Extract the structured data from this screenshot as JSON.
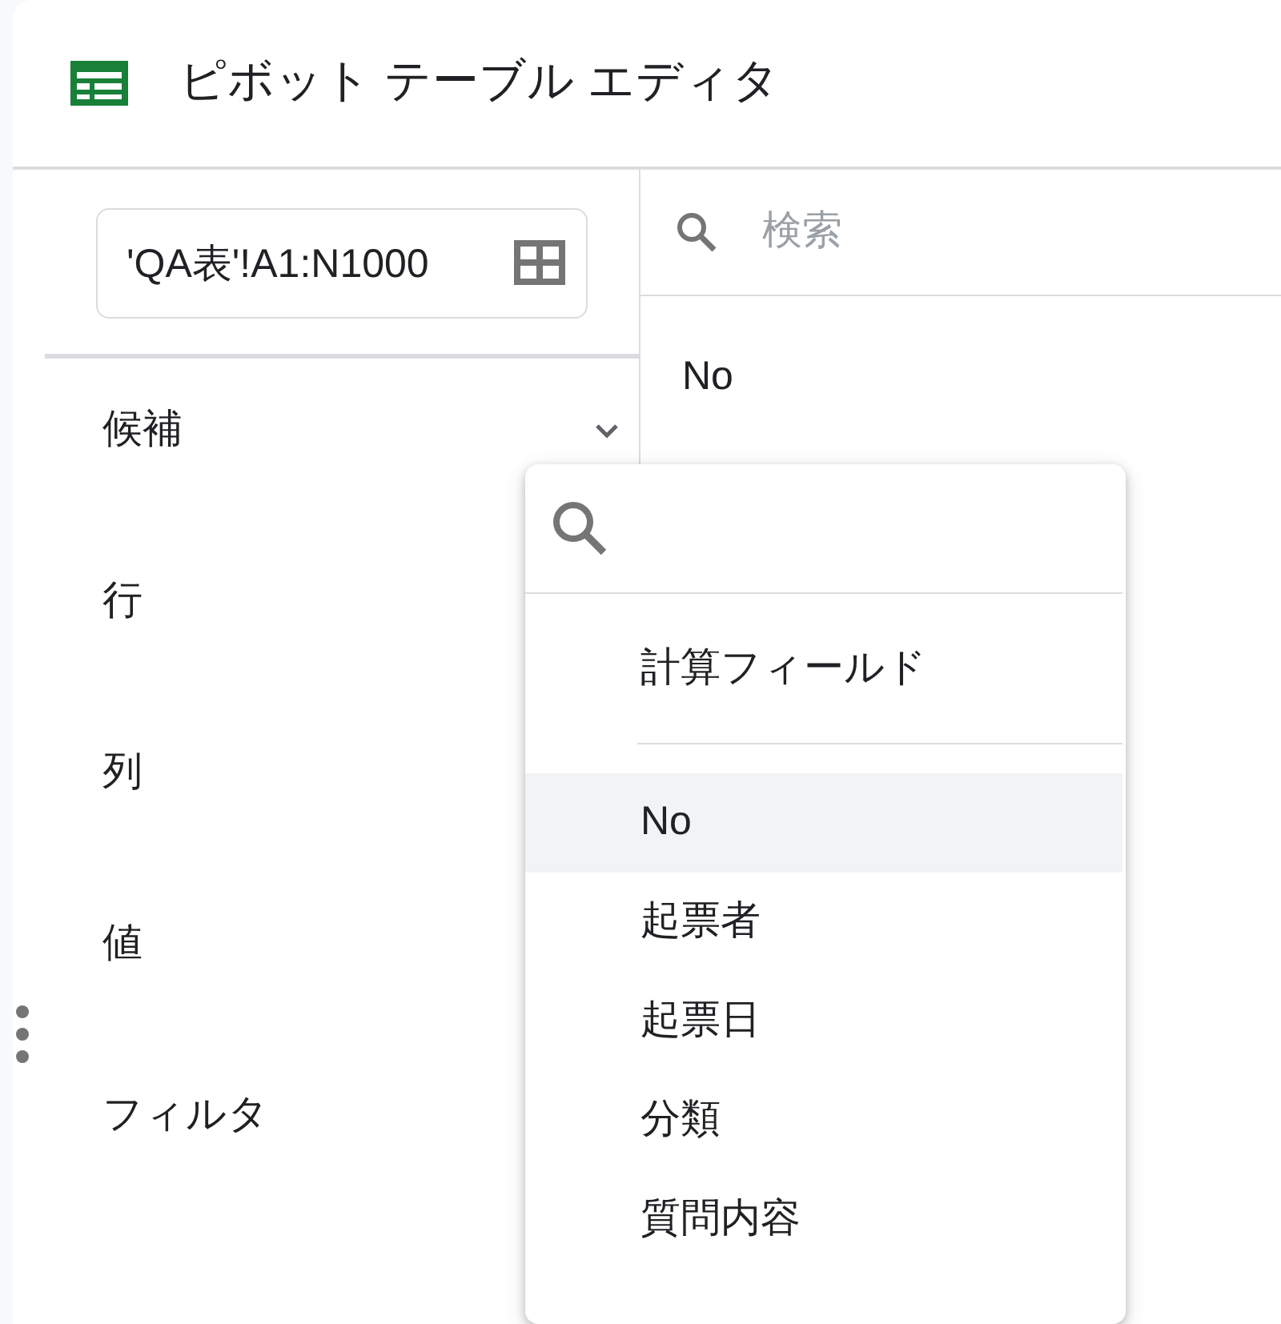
{
  "header": {
    "title": "ピボット テーブル エディタ"
  },
  "range": {
    "value": "'QA表'!A1:N1000"
  },
  "sections": [
    {
      "label": "候補",
      "expandable": true
    },
    {
      "label": "行",
      "expandable": false
    },
    {
      "label": "列",
      "expandable": false
    },
    {
      "label": "値",
      "expandable": false
    },
    {
      "label": "フィルタ",
      "expandable": false
    }
  ],
  "field_panel": {
    "search_placeholder": "検索",
    "fields": [
      "No"
    ]
  },
  "dropdown": {
    "calculated_field": "計算フィールド",
    "items": [
      {
        "label": "No",
        "highlighted": true
      },
      {
        "label": "起票者",
        "highlighted": false
      },
      {
        "label": "起票日",
        "highlighted": false
      },
      {
        "label": "分類",
        "highlighted": false
      },
      {
        "label": "質問内容",
        "highlighted": false
      }
    ]
  }
}
